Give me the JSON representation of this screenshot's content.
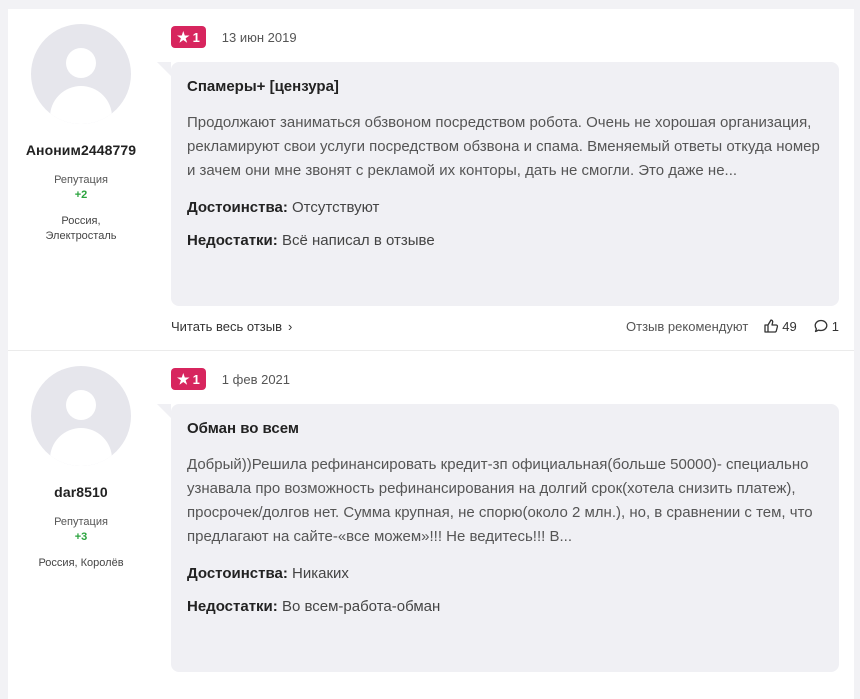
{
  "reviews": [
    {
      "author": "Аноним2448779",
      "reputation_label": "Репутация",
      "reputation": "+2",
      "location": [
        "Россия,",
        "Электросталь"
      ],
      "rating": "1",
      "date": "13 июн 2019",
      "title": "Спамеры+ [цензура]",
      "text": "Продолжают заниматься обзвоном посредством робота. Очень не хорошая организация, рекламируют свои услуги посредством обзвона и спама. Вменяемый ответы откуда номер и зачем они мне звонят с рекламой их конторы, дать не смогли. Это даже не...",
      "pros_label": "Достоинства:",
      "pros": "Отсутствуют",
      "cons_label": "Недостатки:",
      "cons": "Всё написал в отзыве",
      "read_more": "Читать весь отзыв",
      "recommend": "Отзыв рекомендуют",
      "likes": "49",
      "comments": "1"
    },
    {
      "author": "dar8510",
      "reputation_label": "Репутация",
      "reputation": "+3",
      "location": [
        "Россия, Королёв"
      ],
      "rating": "1",
      "date": "1 фев 2021",
      "title": "Обман во всем",
      "text": "Добрый))Решила рефинансировать кредит-зп официальная(больше 50000)- специально узнавала про возможность рефинансирования на долгий срок(хотела снизить платеж), просрочек/долгов нет. Сумма крупная, не спорю(около 2 млн.), но, в сравнении с тем, что предлагают на сайте-«все можем»!!! Не ведитесь!!! В...",
      "pros_label": "Достоинства:",
      "pros": "Никаких",
      "cons_label": "Недостатки:",
      "cons": "Во всем-работа-обман"
    }
  ],
  "colors": {
    "badge": "#d7255e",
    "reputation": "#2aa33d",
    "bubble": "#f0f0f4"
  },
  "icons": {
    "rating": "star-icon",
    "like": "thumbs-up-icon",
    "comment": "comment-icon",
    "chevron": "chevron-right-icon"
  }
}
